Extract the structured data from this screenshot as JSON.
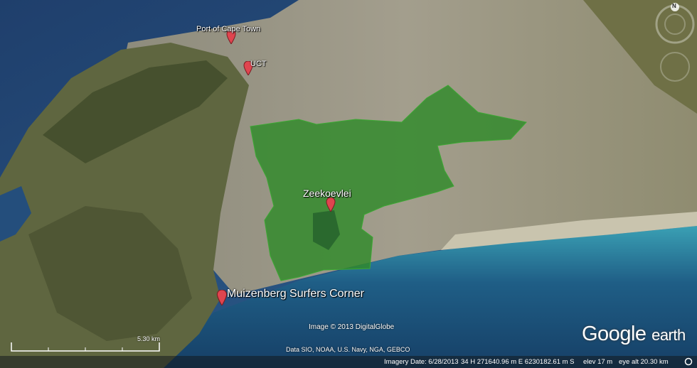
{
  "pins": {
    "port": {
      "label": "Port of Cape Town"
    },
    "uct": {
      "label": "UCT"
    },
    "zeekoevlei": {
      "label": "Zeekoevlei"
    },
    "muizenberg": {
      "label": "Muizenberg Surfers Corner"
    }
  },
  "credits": {
    "image": "Image © 2013 DigitalGlobe",
    "data": "Data SIO, NOAA, U.S. Navy, NGA, GEBCO"
  },
  "scale": {
    "label": "5.30 km"
  },
  "logo": {
    "google": "Google",
    "earth": "earth"
  },
  "status": {
    "imagery_date": "Imagery Date: 6/28/2013",
    "coordinates": "34 H 271640.96 m E 6230182.61 m S",
    "elev": "elev   17 m",
    "eye_alt": "eye alt  20.30 km"
  },
  "nav": {
    "north_label": "N"
  },
  "icons": {
    "pin": "map-pin-icon",
    "compass": "compass-icon",
    "status": "streaming-status-icon"
  },
  "colors": {
    "region_fill": "#2f8a2a",
    "ocean": "#1d4a78",
    "pin": "#e0454f"
  }
}
